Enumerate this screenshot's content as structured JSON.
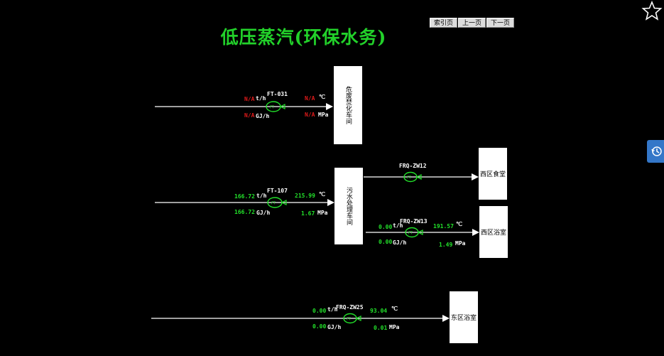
{
  "title": "低压蒸汽(环保水务)",
  "nav": {
    "index": "索引页",
    "prev": "上一页",
    "next": "下一页"
  },
  "icons": {
    "favorite": "star-icon",
    "history": "history-icon"
  },
  "flows": {
    "ft031": {
      "tag": "FT-031",
      "flow": "N/A",
      "flow_unit": "t/h",
      "energy": "N/A",
      "energy_unit": "GJ/h",
      "temp": "N/A",
      "temp_unit": "℃",
      "pressure": "N/A",
      "pressure_unit": "MPa",
      "dest": "危废焚化车间"
    },
    "ft107": {
      "tag": "FT-107",
      "flow": "166.72",
      "flow_unit": "t/h",
      "energy": "166.72",
      "energy_unit": "GJ/h",
      "temp": "215.99",
      "temp_unit": "℃",
      "pressure": "1.67",
      "pressure_unit": "MPa",
      "dest": "污水处理车间"
    },
    "frqzw12": {
      "tag": "FRQ-ZW12",
      "dest": "西区食堂"
    },
    "frqzw13": {
      "tag": "FRQ-ZW13",
      "flow": "0.00",
      "flow_unit": "t/h",
      "energy": "0.00",
      "energy_unit": "GJ/h",
      "temp": "191.57",
      "temp_unit": "℃",
      "pressure": "1.49",
      "pressure_unit": "MPa",
      "dest": "西区浴室"
    },
    "frqzw25": {
      "tag": "FRQ-ZW25",
      "flow": "0.00",
      "flow_unit": "t/h",
      "energy": "0.00",
      "energy_unit": "GJ/h",
      "temp": "93.04",
      "temp_unit": "℃",
      "pressure": "0.01",
      "pressure_unit": "MPa",
      "dest": "东区浴室"
    }
  },
  "meter_label": "FT"
}
